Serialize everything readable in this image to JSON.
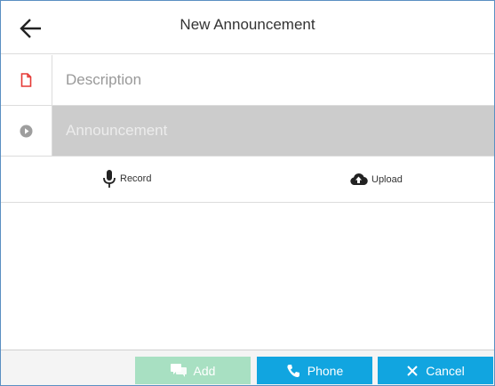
{
  "header": {
    "title": "New Announcement",
    "back_icon": "arrow-left-icon"
  },
  "form": {
    "description": {
      "placeholder": "Description",
      "value": "",
      "icon": "file-icon",
      "icon_color": "#e53935"
    },
    "announcement": {
      "placeholder": "Announcement",
      "value": "",
      "icon": "play-circle-icon",
      "icon_color": "#9e9e9e",
      "disabled": true
    }
  },
  "actions": {
    "record_label": "Record",
    "record_icon": "microphone-icon",
    "upload_label": "Upload",
    "upload_icon": "cloud-upload-icon"
  },
  "footer": {
    "add_label": "Add",
    "add_icon": "chat-icon",
    "add_disabled": true,
    "phone_label": "Phone",
    "phone_icon": "phone-icon",
    "cancel_label": "Cancel",
    "cancel_icon": "close-icon",
    "accent_color": "#11a5e0",
    "disabled_color": "#a8e0c2"
  }
}
